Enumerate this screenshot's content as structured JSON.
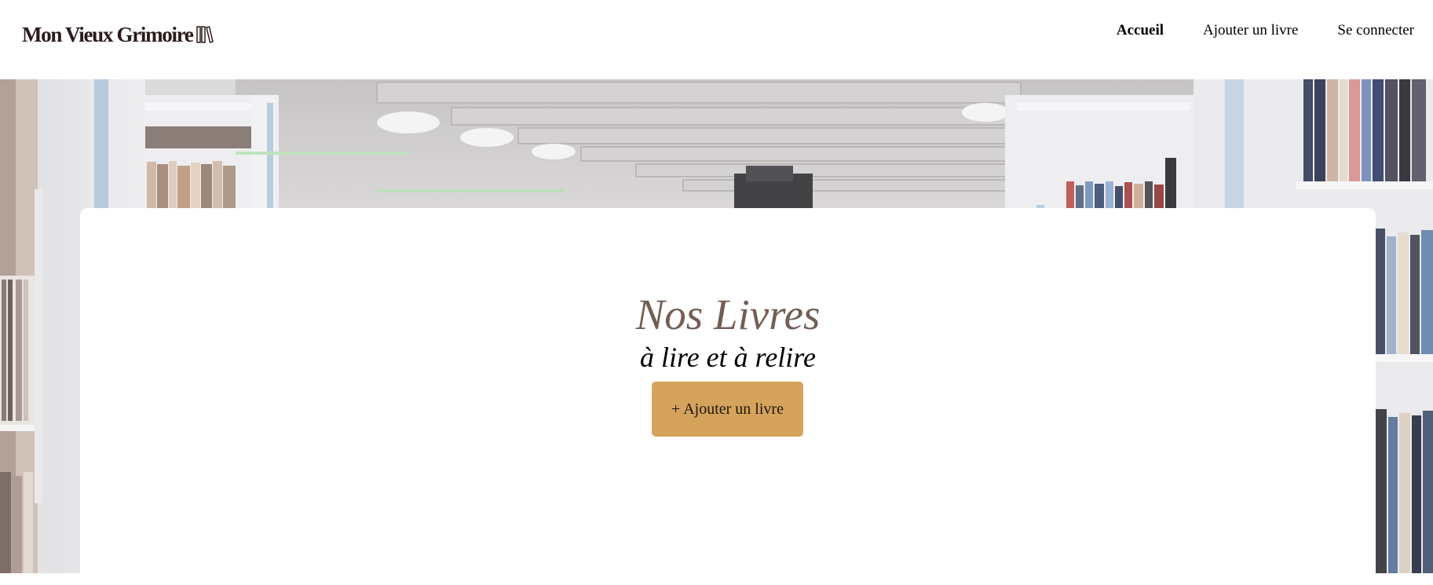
{
  "header": {
    "logo_text": "Mon Vieux Grimoire",
    "logo_icon": "books-icon",
    "nav": [
      {
        "label": "Accueil",
        "active": true
      },
      {
        "label": "Ajouter un livre",
        "active": false
      },
      {
        "label": "Se connecter",
        "active": false
      }
    ]
  },
  "main": {
    "title": "Nos Livres",
    "subtitle": "à lire et à relire",
    "add_button_label": "+ Ajouter un livre"
  },
  "colors": {
    "title": "#735e55",
    "button": "#d5a35c",
    "logo": "#2a1c1a"
  }
}
